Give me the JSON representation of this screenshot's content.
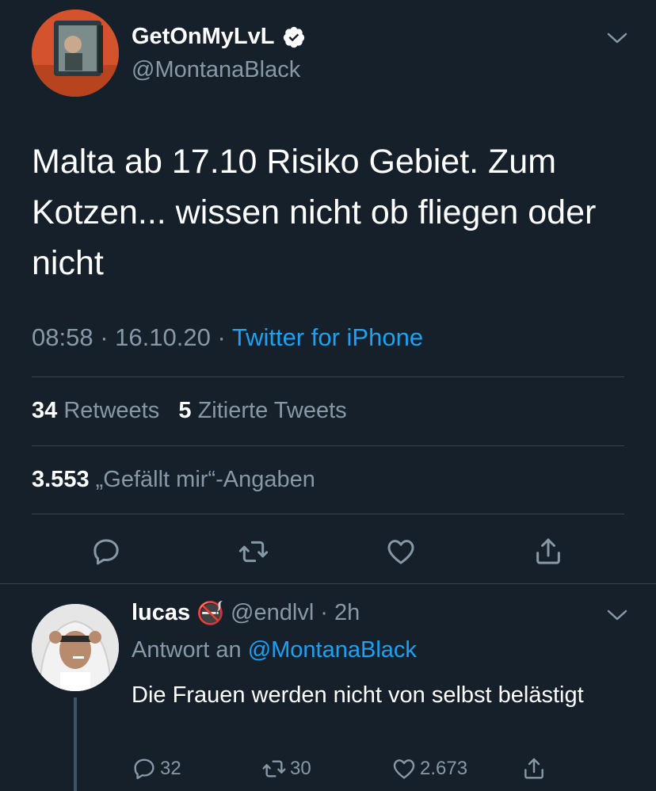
{
  "tweet": {
    "display_name": "GetOnMyLvL",
    "handle": "@MontanaBlack",
    "text": "Malta ab 17.10 Risiko Gebiet. Zum Kotzen... wissen nicht ob fliegen oder nicht",
    "time": "08:58",
    "date": "16.10.20",
    "separator": "·",
    "source": "Twitter for iPhone",
    "retweets_count": "34",
    "retweets_label": "Retweets",
    "quotes_count": "5",
    "quotes_label": "Zitierte Tweets",
    "likes_count": "3.553",
    "likes_label": "„Gefällt mir“-Angaben",
    "verified_icon": "verified-badge-icon",
    "actions": [
      "reply-icon",
      "retweet-icon",
      "like-icon",
      "share-icon"
    ]
  },
  "reply": {
    "display_name": "lucas",
    "emoji": "🚭",
    "handle": "@endlvl",
    "separator": "·",
    "age": "2h",
    "reply_prefix": "Antwort an",
    "reply_mention": "@MontanaBlack",
    "text": "Die Frauen werden nicht von selbst belästigt",
    "reply_count": "32",
    "retweet_count": "30",
    "like_count": "2.673"
  },
  "colors": {
    "background": "#15202b",
    "text_primary": "#ffffff",
    "text_secondary": "#8899a6",
    "accent": "#1da1f2",
    "divider": "#38444d"
  }
}
